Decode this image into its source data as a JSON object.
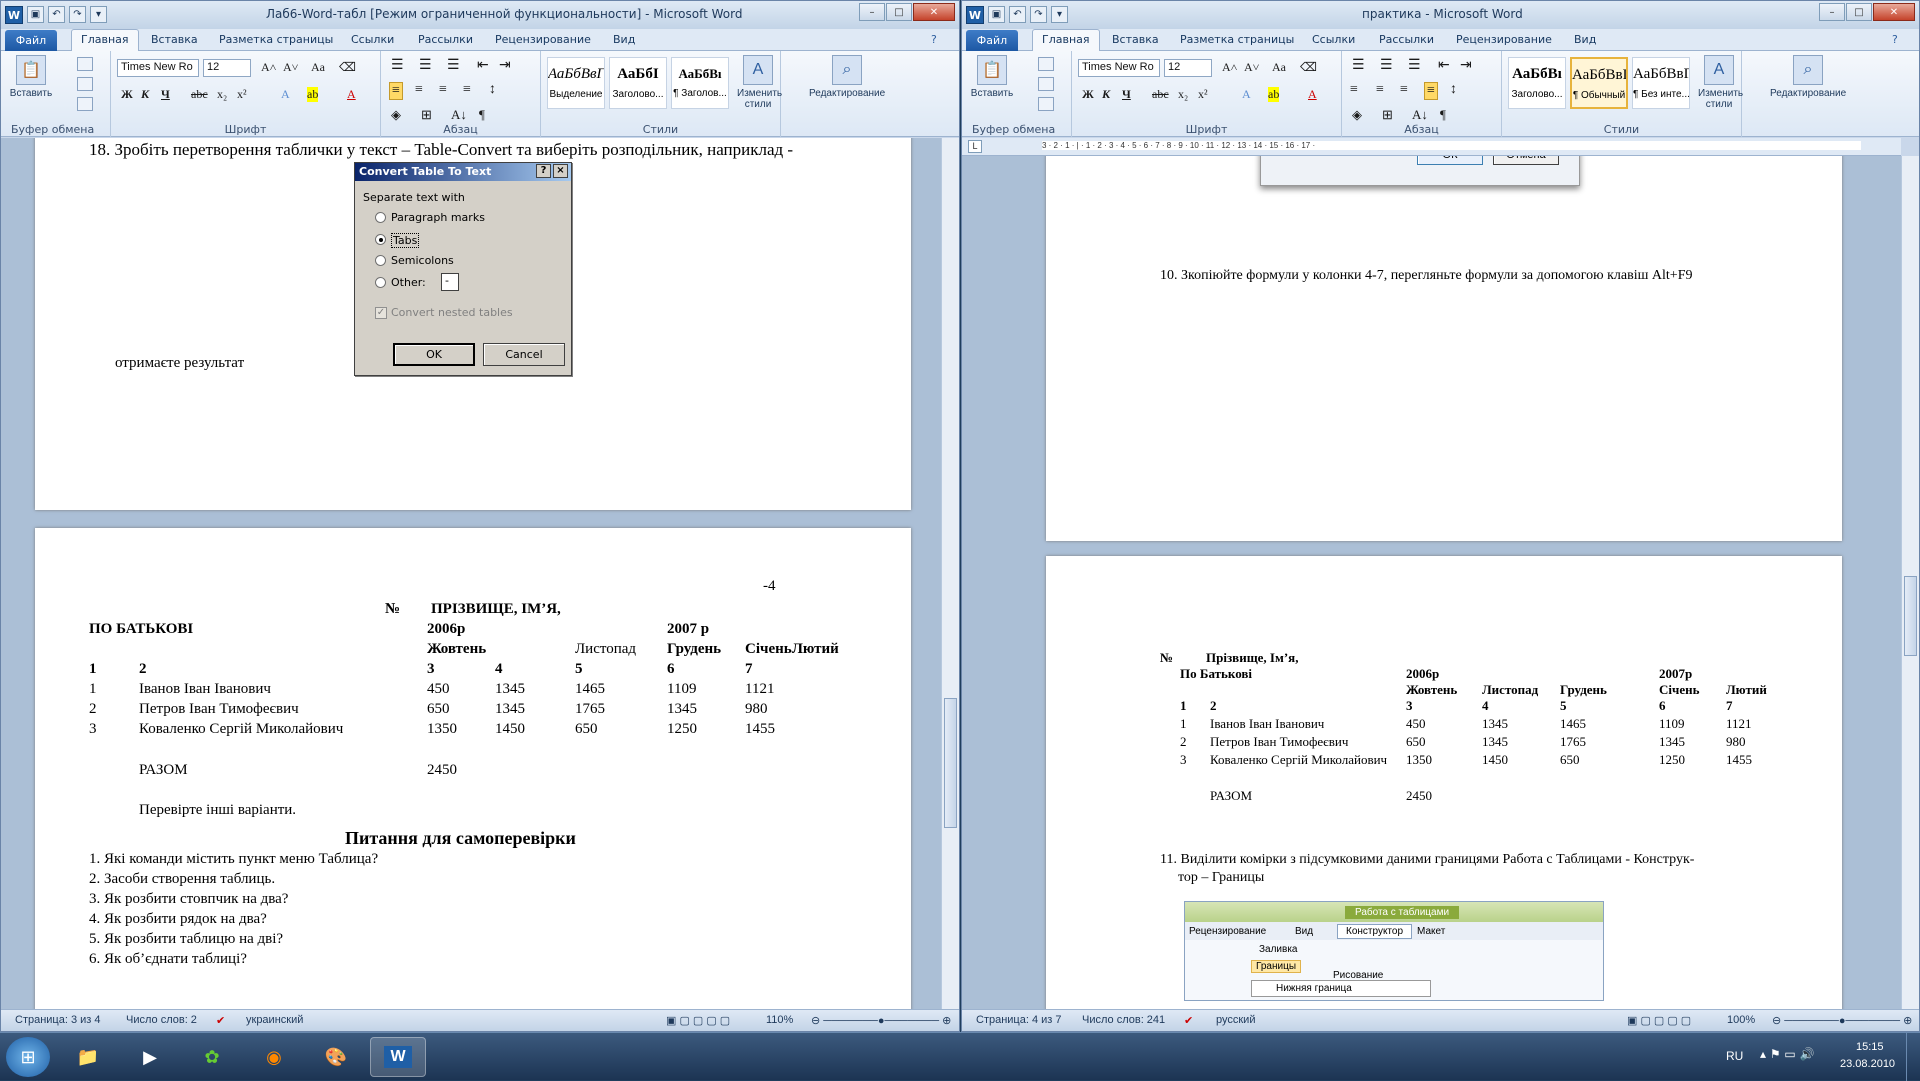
{
  "left_window": {
    "title": "Лаб6-Word-табл [Режим ограниченной функциональности]  -  Microsoft Word",
    "tabs": [
      "Файл",
      "Главная",
      "Вставка",
      "Разметка страницы",
      "Ссылки",
      "Рассылки",
      "Рецензирование",
      "Вид"
    ],
    "font_name": "Times New Ro",
    "font_size": "12",
    "groups": [
      "Буфер обмена",
      "Шрифт",
      "Абзац",
      "Стили"
    ],
    "paste_label": "Вставить",
    "styles": [
      {
        "sample": "АаБбВвГ",
        "name": "Выделение"
      },
      {
        "sample": "АаБбІ",
        "name": "Заголово..."
      },
      {
        "sample": "АаБбВı",
        "name": "¶ Заголов..."
      }
    ],
    "change_styles": "Изменить стили",
    "editing": "Редактирование",
    "doc": {
      "item18": "18.  Зробіть перетворення таблички  у текст – Table-Convert та виберіть розподільник, наприклад -",
      "result_text": "отримаєте результат",
      "page_num": "-4",
      "header_row1": [
        "№",
        "ПРІЗВИЩЕ, ІМ’Я,"
      ],
      "header_row2": [
        "ПО БАТЬКОВІ",
        "2006р",
        "2007 р"
      ],
      "header_row3": [
        "Жовтень",
        "Листопад",
        "Грудень",
        "СіченьЛютий"
      ],
      "header_row4": [
        "1",
        "2",
        "3",
        "4",
        "5",
        "6",
        "7"
      ],
      "rows": [
        [
          "1",
          "Іванов Іван Іванович",
          "450",
          "1345",
          "1465",
          "1109",
          "1121"
        ],
        [
          "2",
          "Петров Іван Тимофеєвич",
          "650",
          "1345",
          "1765",
          "1345",
          "980"
        ],
        [
          "3",
          "Коваленко Сергій Миколайович",
          "1350",
          "1450",
          "650",
          "1250",
          "1455"
        ]
      ],
      "total_label": "РАЗОМ",
      "total_value": "2450",
      "check_other": "Перевірте інші варіанти.",
      "questions_title": "Питання для самоперевірки",
      "questions": [
        "1.   Які команди містить пункт меню Таблица?",
        "2.   Засоби створення таблиць.",
        "3.   Як розбити стовпчик на два?",
        "4.   Як розбити рядок на два?",
        "5.   Як розбити таблицю на дві?",
        "6.   Як об’єднати таблиці?"
      ]
    },
    "dialog": {
      "title": "Convert Table To Text",
      "help": "?",
      "close": "×",
      "section": "Separate text with",
      "options": [
        "Paragraph marks",
        "Tabs",
        "Semicolons",
        "Other:"
      ],
      "other_value": "-",
      "nested": "Convert nested tables",
      "ok": "OK",
      "cancel": "Cancel"
    },
    "status": {
      "page": "Страница: 3 из 4",
      "words": "Число слов: 2",
      "lang": "украинский",
      "zoom": "110%"
    }
  },
  "right_window": {
    "title": "практика  -  Microsoft Word",
    "tabs": [
      "Файл",
      "Главная",
      "Вставка",
      "Разметка страницы",
      "Ссылки",
      "Рассылки",
      "Рецензирование",
      "Вид"
    ],
    "font_name": "Times New Ro",
    "font_size": "12",
    "groups": [
      "Буфер обмена",
      "Шрифт",
      "Абзац",
      "Стили"
    ],
    "paste_label": "Вставить",
    "styles": [
      {
        "sample": "АаБбВı",
        "name": "Заголово..."
      },
      {
        "sample": "АаБбВвГ",
        "name": "¶ Обычный"
      },
      {
        "sample": "АаБбВвГ",
        "name": "¶ Без инте..."
      }
    ],
    "change_styles": "Изменить стили",
    "editing": "Редактирование",
    "ruler": "3 · 2 · 1 · | · 1 · 2 · 3 · 4 · 5 · 6 · 7 · 8 · 9 · 10 · 11 · 12 · 13 · 14 · 15 · 16 · 17 ·",
    "dialog_ok": "ОК",
    "dialog_cancel": "Отмена",
    "doc": {
      "item10": "10.  Зкопіюйте формули у колонки 4-7, перегляньте формули за допомогою клавіш Alt+F9",
      "h1": [
        "№",
        "Прізвище, Ім’я,"
      ],
      "h2": [
        "По Батькові",
        "2006р",
        "2007р"
      ],
      "h3": [
        "Жовтень",
        "Листопад",
        "Грудень",
        "Січень",
        "Лютий"
      ],
      "h4": [
        "1",
        "2",
        "3",
        "4",
        "5",
        "6",
        "7"
      ],
      "rows": [
        [
          "1",
          "Іванов Іван Іванович",
          "450",
          "1345",
          "1465",
          "1109",
          "1121"
        ],
        [
          "2",
          "Петров Іван Тимофеєвич",
          "650",
          "1345",
          "1765",
          "1345",
          "980"
        ],
        [
          "3",
          "Коваленко Сергій Миколайович",
          "1350",
          "1450",
          "650",
          "1250",
          "1455"
        ]
      ],
      "total_label": "РАЗОМ",
      "total_value": "2450",
      "item11_a": "11.  Виділити комірки з підсумковими даними границями Работа с Таблицами - Конструк-",
      "item11_b": "тор – Границы",
      "shot_tabs": [
        "Работа с таблицами",
        "Рецензирование",
        "Вид",
        "Конструктор",
        "Макет"
      ],
      "shot_fill": "Заливка",
      "shot_borders": "Границы",
      "shot_draw": "Рисование",
      "shot_bottom": "Нижняя граница"
    },
    "status": {
      "page": "Страница: 4 из 7",
      "words": "Число слов: 241",
      "lang": "русский",
      "zoom": "100%"
    }
  },
  "taskbar": {
    "lang": "RU",
    "time": "15:15",
    "date": "23.08.2010"
  }
}
